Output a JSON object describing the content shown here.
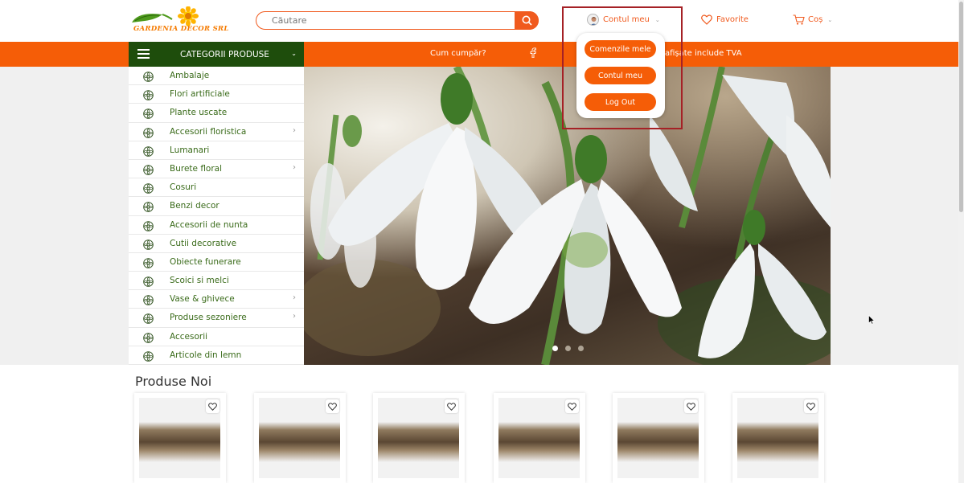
{
  "header": {
    "logo_text": "GARDENIA DECOR SRL",
    "search_placeholder": "Căutare",
    "account_label": "Contul meu",
    "favorites_label": "Favorite",
    "cart_label": "Coș"
  },
  "navbar": {
    "categories_title": "CATEGORII PRODUSE",
    "how_to_buy": "Cum cumpăr?",
    "vat_note": "afișate include TVA"
  },
  "account_menu": {
    "items": [
      "Comenzile mele",
      "Contul meu",
      "Log Out"
    ]
  },
  "categories": [
    {
      "label": "Ambalaje",
      "has_sub": false
    },
    {
      "label": "Flori artificiale",
      "has_sub": false
    },
    {
      "label": "Plante uscate",
      "has_sub": false
    },
    {
      "label": "Accesorii floristica",
      "has_sub": true
    },
    {
      "label": "Lumanari",
      "has_sub": false
    },
    {
      "label": "Burete floral",
      "has_sub": true
    },
    {
      "label": "Cosuri",
      "has_sub": false
    },
    {
      "label": "Benzi decor",
      "has_sub": false
    },
    {
      "label": "Accesorii de nunta",
      "has_sub": false
    },
    {
      "label": "Cutii decorative",
      "has_sub": false
    },
    {
      "label": "Obiecte funerare",
      "has_sub": false
    },
    {
      "label": "Scoici si melci",
      "has_sub": false
    },
    {
      "label": "Vase & ghivece",
      "has_sub": true
    },
    {
      "label": "Produse sezoniere",
      "has_sub": true
    },
    {
      "label": "Accesorii",
      "has_sub": false
    },
    {
      "label": "Articole din lemn",
      "has_sub": false
    }
  ],
  "slider": {
    "slide_count": 3,
    "active_slide": 1
  },
  "products_section": {
    "title": "Produse Noi",
    "product_count": 6
  },
  "icons": {
    "category": "flower-outline-icon",
    "submenu": "chevron-right-icon",
    "favorite": "heart-icon",
    "cart": "cart-icon",
    "search": "search-icon",
    "social": "facebook-icon"
  },
  "colors": {
    "accent": "#f55d07",
    "category_header": "#1e4d0c",
    "category_text": "#3a6b1a",
    "highlight_outline": "#a52126"
  }
}
